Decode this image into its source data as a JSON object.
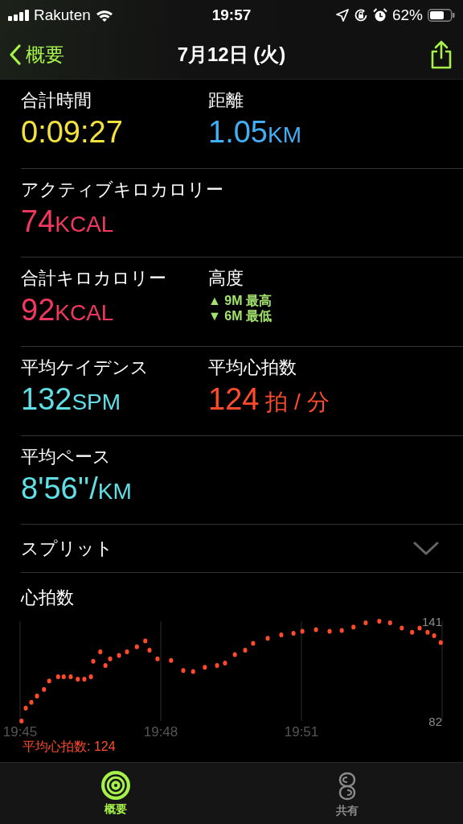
{
  "status_bar": {
    "carrier": "Rakuten",
    "time": "19:57",
    "battery": "62%"
  },
  "nav": {
    "back": "概要",
    "title": "7月12日 (火)"
  },
  "metric_rows": [
    {
      "cells": [
        {
          "kind": "value",
          "label": "合計時間",
          "value": "0:09:27",
          "color": "#f3e23e"
        },
        {
          "kind": "value",
          "label": "距離",
          "value": "1.05",
          "unit": "KM",
          "color": "#42aef5"
        }
      ]
    },
    {
      "cells": [
        {
          "kind": "value",
          "label": "アクティブキロカロリー",
          "value": "74",
          "unit": "KCAL",
          "color": "#f0385e"
        }
      ]
    },
    {
      "cells": [
        {
          "kind": "value",
          "label": "合計キロカロリー",
          "value": "92",
          "unit": "KCAL",
          "color": "#f0385e"
        },
        {
          "kind": "range",
          "label": "高度",
          "lines": [
            "▲ 9M 最高",
            "▼ 6M 最低"
          ],
          "color": "#a3e36e"
        }
      ]
    },
    {
      "cells": [
        {
          "kind": "value",
          "label": "平均ケイデンス",
          "value": "132",
          "unit": "SPM",
          "color": "#5fe0e6"
        },
        {
          "kind": "value",
          "label": "平均心拍数",
          "value": "124",
          "unit": " 拍 / 分",
          "color": "#ff4b2b"
        }
      ]
    },
    {
      "cells": [
        {
          "kind": "value",
          "label": "平均ペース",
          "value": "8'56''/",
          "unit": "KM",
          "color": "#5fe0e6"
        }
      ]
    }
  ],
  "splits": {
    "label": "スプリット",
    "expanded": false
  },
  "heart_rate": {
    "title": "心拍数",
    "average": "平均心拍数: 124",
    "chart_data": {
      "type": "scatter",
      "xlim": [
        1185,
        1194
      ],
      "ylim": [
        82,
        141
      ],
      "xticks": [
        {
          "value": 1185,
          "label": "19:45"
        },
        {
          "value": 1188,
          "label": "19:48"
        },
        {
          "value": 1191,
          "label": "19:51"
        }
      ],
      "yticks": [
        82,
        141
      ],
      "series": [
        {
          "color": "#ff4b2b",
          "x": [
            1185.03,
            1185.12,
            1185.24,
            1185.36,
            1185.51,
            1185.62,
            1185.81,
            1185.93,
            1186.08,
            1186.23,
            1186.37,
            1186.51,
            1186.56,
            1186.71,
            1186.82,
            1186.92,
            1187.11,
            1187.28,
            1187.49,
            1187.67,
            1187.76,
            1187.93,
            1188.22,
            1188.48,
            1188.69,
            1188.94,
            1189.2,
            1189.37,
            1189.58,
            1189.8,
            1189.97,
            1190.28,
            1190.57,
            1190.83,
            1191.02,
            1191.31,
            1191.6,
            1191.86,
            1192.11,
            1192.37,
            1192.66,
            1192.89,
            1193.14,
            1193.36,
            1193.52,
            1193.69,
            1193.83,
            1193.97
          ],
          "values": [
            82,
            89.6,
            93.1,
            96.7,
            100.7,
            105.7,
            108.2,
            108.2,
            108.2,
            106.7,
            106.7,
            108.2,
            117.3,
            122.9,
            114.8,
            118.8,
            120.8,
            122.9,
            125.9,
            129.4,
            123.9,
            118.8,
            117.8,
            111.8,
            111.3,
            113.8,
            114.8,
            116.3,
            121.3,
            123.9,
            127.9,
            130.9,
            132.9,
            133.9,
            135,
            136,
            135,
            135.5,
            137.5,
            140,
            141,
            140,
            137,
            134.4,
            137,
            134.4,
            132.4,
            128.4
          ]
        }
      ]
    }
  },
  "tabs": [
    {
      "label": "概要",
      "kind": "rings",
      "selected": true
    },
    {
      "label": "共有",
      "kind": "sharing",
      "selected": false
    }
  ]
}
